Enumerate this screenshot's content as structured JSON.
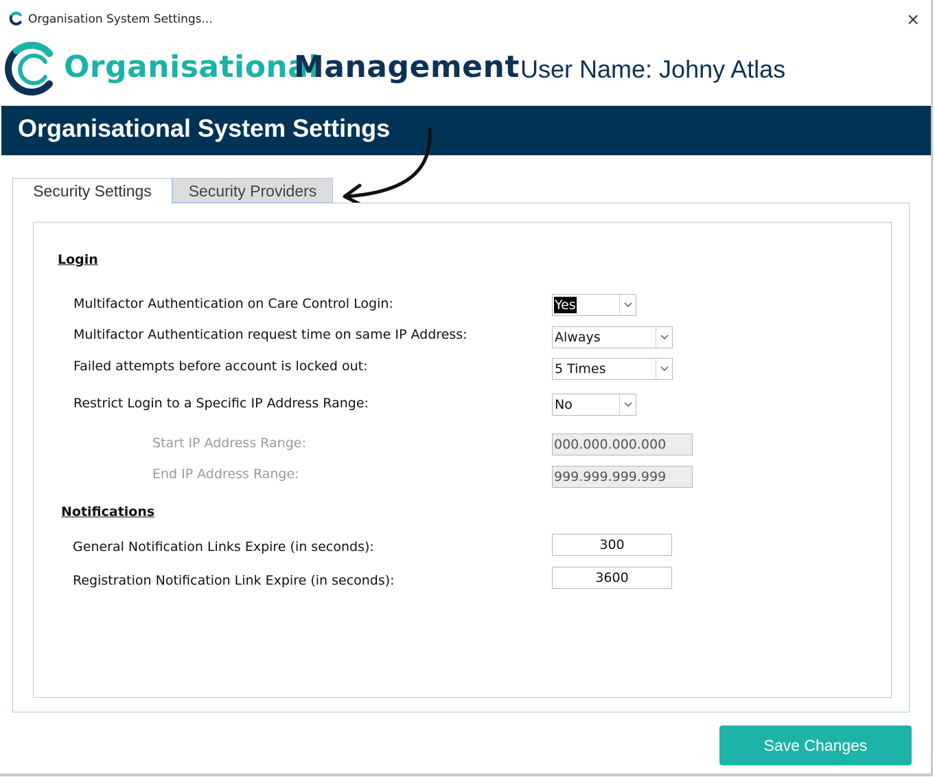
{
  "window": {
    "title": "Organisation System Settings...",
    "close_glyph": "×"
  },
  "brand": {
    "word1": "Organisational",
    "word2": "Management",
    "user_label": "User Name: Johny Atlas",
    "colors": {
      "teal": "#1bb3a7",
      "navy": "#0d3256"
    }
  },
  "header": {
    "title": "Organisational System Settings",
    "background": "#003356"
  },
  "tabs": [
    {
      "label": "Security Settings",
      "active": true
    },
    {
      "label": "Security Providers",
      "active": false
    }
  ],
  "login": {
    "heading": "Login",
    "fields": [
      {
        "label": "Multifactor Authentication on Care Control Login:",
        "value": "Yes"
      },
      {
        "label": "Multifactor Authentication request time on same IP Address:",
        "value": "Always"
      },
      {
        "label": "Failed attempts before account is locked out:",
        "value": "5 Times"
      },
      {
        "label": "Restrict Login to a Specific IP Address Range:",
        "value": "No"
      }
    ],
    "ip_range": [
      {
        "label": "Start IP Address Range:",
        "value": "000.000.000.000"
      },
      {
        "label": "End IP Address Range:",
        "value": "999.999.999.999"
      }
    ]
  },
  "notifications": {
    "heading": "Notifications",
    "fields": [
      {
        "label": "General Notification Links Expire (in seconds):",
        "value": "300"
      },
      {
        "label": "Registration Notification Link Expire (in seconds):",
        "value": "3600"
      }
    ]
  },
  "actions": {
    "save_label": "Save Changes",
    "save_color": "#1db3a8"
  },
  "icons": {
    "app": "c-logo-icon",
    "brand": "c-logo-icon",
    "dropdown": "chevron-down-icon",
    "annotation": "curved-arrow-icon"
  }
}
